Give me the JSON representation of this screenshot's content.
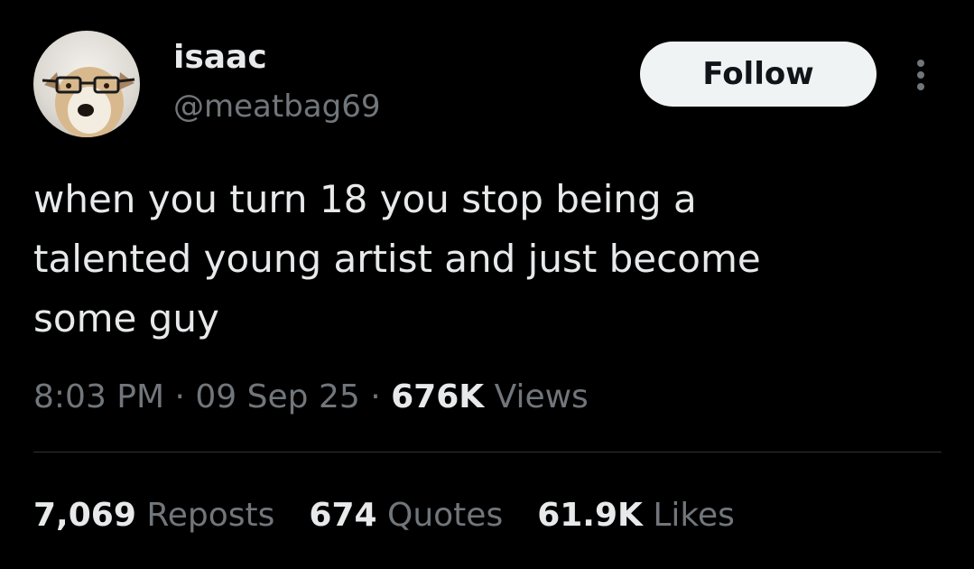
{
  "author": {
    "display_name": "isaac",
    "handle": "@meatbag69",
    "avatar_icon": "dog-with-glasses-avatar"
  },
  "actions": {
    "follow_label": "Follow",
    "more_icon": "more-vertical-icon"
  },
  "tweet": {
    "text": "when you turn 18 you stop being a\ntalented young artist and just become\nsome guy"
  },
  "meta": {
    "time": "8:03 PM",
    "separator": " · ",
    "date": "09 Sep 25",
    "views_count": "676K",
    "views_label": "Views"
  },
  "stats": {
    "reposts_count": "7,069",
    "reposts_label": "Reposts",
    "quotes_count": "674",
    "quotes_label": "Quotes",
    "likes_count": "61.9K",
    "likes_label": "Likes"
  },
  "colors": {
    "background": "#000000",
    "primary_text": "#e7e9ea",
    "secondary_text": "#71767b",
    "follow_button_bg": "#eff3f4",
    "divider": "#2f3336"
  }
}
